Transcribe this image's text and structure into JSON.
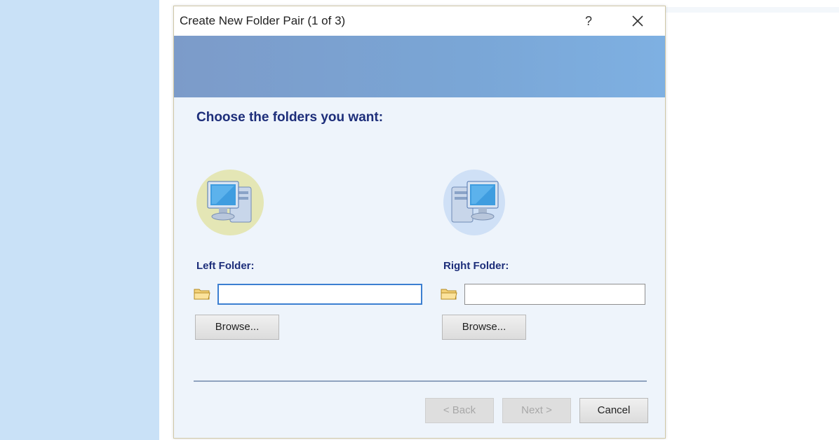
{
  "dialog": {
    "title": "Create New Folder Pair (1 of 3)",
    "help_label": "?",
    "close_label": "×",
    "heading": "Choose the folders you want:"
  },
  "left": {
    "label": "Left Folder:",
    "path_value": "",
    "browse_label": "Browse..."
  },
  "right": {
    "label": "Right Folder:",
    "path_value": "",
    "browse_label": "Browse..."
  },
  "footer": {
    "back_label": "< Back",
    "next_label": "Next >",
    "cancel_label": "Cancel"
  },
  "icons": {
    "left_computer": "computer-icon",
    "right_computer": "computer-icon",
    "folder": "folder-icon",
    "close": "close-icon"
  },
  "colors": {
    "heading": "#1d2e7a",
    "banner_start": "#7c9bc9",
    "banner_end": "#7eb0e2",
    "left_panel": "#c9e1f7",
    "focus_border": "#3c7fd1"
  }
}
